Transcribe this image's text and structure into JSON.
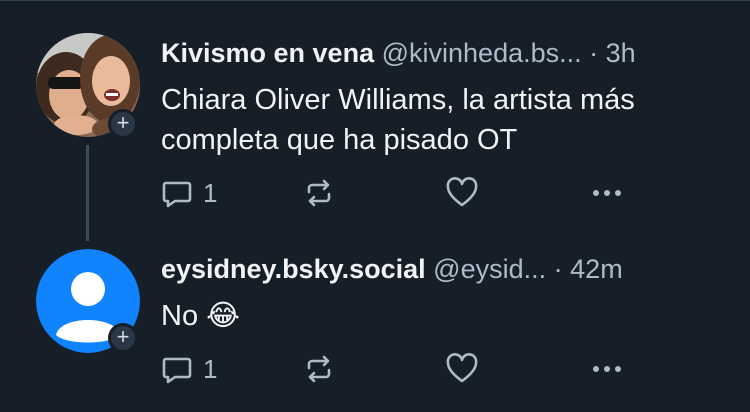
{
  "posts": [
    {
      "author_name": "Kivismo en vena",
      "handle": "@kivinheda.bs...",
      "separator": "·",
      "time": "3h",
      "text": "Chiara Oliver Williams, la artista más completa que ha pisado OT",
      "text_lines": [
        "Chiara Oliver Williams, la artista más",
        "completa que ha pisado OT"
      ],
      "reply_count": "1",
      "avatar": "photo-avatar",
      "follow_icon": "+"
    },
    {
      "author_name": "eysidney.bsky.social",
      "handle": "@eysid...",
      "separator": "·",
      "time": "42m",
      "text": "No 😂",
      "text_lines": [
        "No 😂"
      ],
      "reply_count": "1",
      "avatar": "default-user-avatar",
      "follow_icon": "+"
    }
  ],
  "colors": {
    "background": "#161e27",
    "text_primary": "#f1f3f5",
    "text_secondary": "#aebbc9",
    "default_avatar": "#1083fe",
    "thread_line": "#3b4a5c"
  },
  "icons": [
    "reply-icon",
    "repost-icon",
    "like-icon",
    "more-options-icon",
    "follow-plus-icon"
  ]
}
